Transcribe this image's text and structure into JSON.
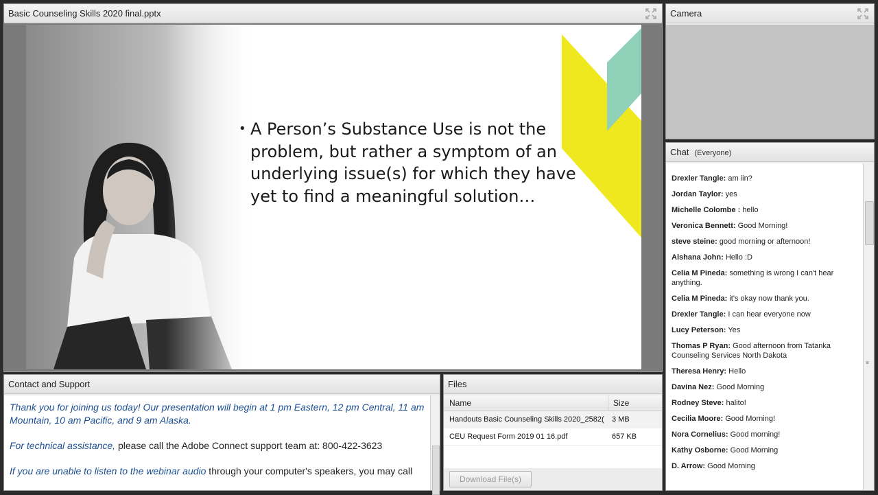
{
  "share": {
    "title": "Basic Counseling Skills 2020 final.pptx",
    "slide_text": "A Person’s Substance Use is not the problem, but rather a symptom of an underlying issue(s) for which they have yet to find a meaningful solution…"
  },
  "camera": {
    "title": "Camera"
  },
  "chat": {
    "title": "Chat",
    "scope": "(Everyone)",
    "messages": [
      {
        "who": "Drexler Tangle:",
        "text": "am iin?"
      },
      {
        "who": "Jordan Taylor:",
        "text": "yes"
      },
      {
        "who": "Michelle  Colombe :",
        "text": "hello"
      },
      {
        "who": "Veronica Bennett:",
        "text": "Good Morning!"
      },
      {
        "who": "steve steine:",
        "text": "good morning or afternoon!"
      },
      {
        "who": "Alshana John:",
        "text": "Hello :D"
      },
      {
        "who": "Celia M Pineda:",
        "text": "something is wrong I can't hear anything."
      },
      {
        "who": "Celia M Pineda:",
        "text": "it's okay now thank you."
      },
      {
        "who": "Drexler Tangle:",
        "text": "I can hear everyone now"
      },
      {
        "who": "Lucy  Peterson:",
        "text": "Yes"
      },
      {
        "who": "Thomas P Ryan:",
        "text": "Good afternoon from Tatanka Counseling Services North Dakota"
      },
      {
        "who": "Theresa Henry:",
        "text": "Hello"
      },
      {
        "who": "Davina Nez:",
        "text": "Good Morning"
      },
      {
        "who": "Rodney Steve:",
        "text": "halito!"
      },
      {
        "who": "Cecilia Moore:",
        "text": "Good Morning!"
      },
      {
        "who": "Nora Cornelius:",
        "text": "Good morning!"
      },
      {
        "who": "Kathy Osborne:",
        "text": "Good Morning"
      },
      {
        "who": "D. Arrow:",
        "text": "Good Morning"
      }
    ]
  },
  "contact": {
    "title": "Contact and Support",
    "para1": "Thank you for joining us today! Our presentation will begin at 1 pm Eastern, 12 pm Central, 11 am Mountain, 10 am Pacific, and 9 am Alaska.",
    "para2_em": "For technical assistance,",
    "para2_rest": " please call the Adobe Connect support team at: 800-422-3623",
    "para3_em": "If you are unable to listen to the webinar audio",
    "para3_rest": " through your computer's speakers, you may call"
  },
  "files": {
    "title": "Files",
    "col_name": "Name",
    "col_size": "Size",
    "rows": [
      {
        "name": "Handouts Basic Counseling Skills 2020_2582(",
        "size": "3 MB"
      },
      {
        "name": "CEU Request Form 2019 01 16.pdf",
        "size": "657 KB"
      }
    ],
    "download_label": "Download File(s)"
  },
  "colors": {
    "accent_yellow": "#f0e81f",
    "accent_teal": "#8fd1b8",
    "link_blue": "#1d4f91"
  }
}
